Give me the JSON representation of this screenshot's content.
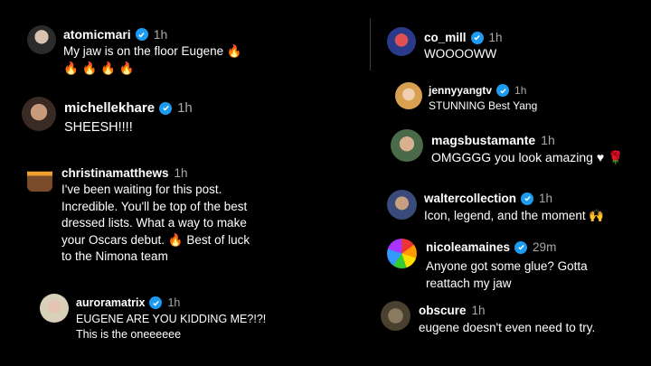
{
  "comments": [
    {
      "username": "atomicmari",
      "verified": true,
      "time": "1h",
      "lines": [
        "My jaw is on the floor Eugene 🔥",
        "🔥 🔥 🔥 🔥"
      ]
    },
    {
      "username": "michellekhare",
      "verified": true,
      "time": "1h",
      "lines": [
        "SHEESH!!!!"
      ]
    },
    {
      "username": "christinamatthews",
      "verified": false,
      "time": "1h",
      "lines": [
        "I've been waiting for this post.",
        "Incredible. You'll be top of the best",
        "dressed lists. What a way to make",
        "your Oscars debut. 🔥 Best of luck",
        "to the Nimona team"
      ]
    },
    {
      "username": "auroramatrix",
      "verified": true,
      "time": "1h",
      "lines": [
        "EUGENE ARE YOU KIDDING ME?!?!",
        "This is the oneeeeee"
      ]
    },
    {
      "username": "co_mill",
      "verified": true,
      "time": "1h",
      "lines": [
        "WOOOOWW"
      ]
    },
    {
      "username": "jennyyangtv",
      "verified": true,
      "time": "1h",
      "lines": [
        "STUNNING Best Yang"
      ]
    },
    {
      "username": "magsbustamante",
      "verified": false,
      "time": "1h",
      "lines": [
        "OMGGGG you look amazing ♥ 🌹"
      ]
    },
    {
      "username": "waltercollection",
      "verified": true,
      "time": "1h",
      "lines": [
        "Icon, legend, and the moment 🙌"
      ]
    },
    {
      "username": "nicoleamaines",
      "verified": true,
      "time": "29m",
      "lines": [
        "Anyone got some glue? Gotta",
        "reattach my jaw"
      ]
    },
    {
      "username": "obscure",
      "verified": false,
      "time": "1h",
      "lines": [
        "eugene doesn't even need to try."
      ]
    }
  ],
  "colors": {
    "verified": "#1d9bf0",
    "time": "#a8a8a8",
    "background": "#000000"
  }
}
